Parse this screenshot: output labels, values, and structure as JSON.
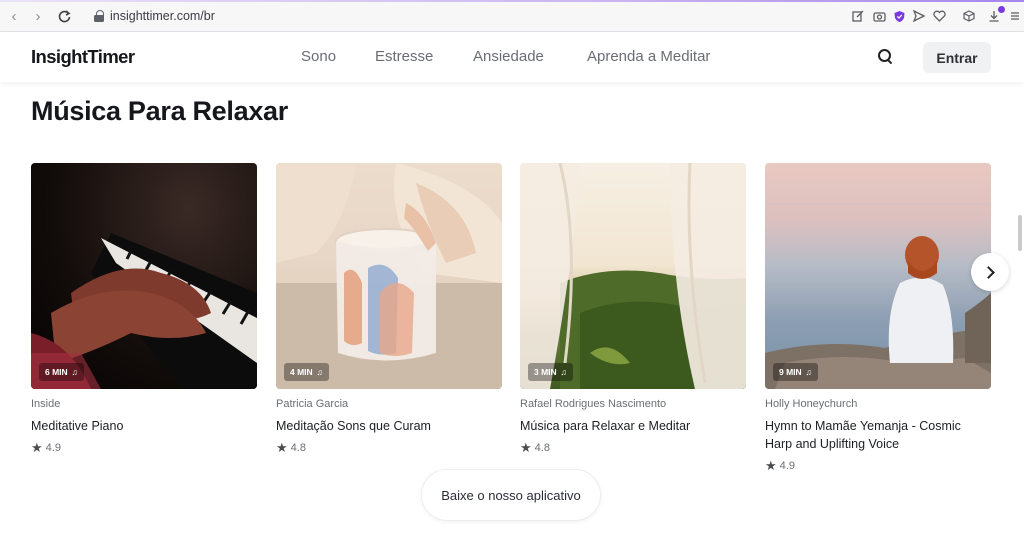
{
  "browser": {
    "url": "insighttimer.com/br",
    "back_icon": "arrow-left-icon",
    "forward_icon": "arrow-right-icon",
    "reload_icon": "reload-icon"
  },
  "header": {
    "logo": "InsightTimer",
    "nav": [
      "Sono",
      "Estresse",
      "Ansiedade",
      "Aprenda a Meditar"
    ],
    "login_label": "Entrar"
  },
  "section": {
    "title": "Música Para Relaxar"
  },
  "cards": [
    {
      "duration": "6 MIN",
      "author": "Inside",
      "title": "Meditative Piano",
      "rating": "4.9"
    },
    {
      "duration": "4 MIN",
      "author": "Patricia Garcia",
      "title": "Meditação Sons que Curam",
      "rating": "4.8"
    },
    {
      "duration": "3 MIN",
      "author": "Rafael Rodrigues Nascimento",
      "title": "Música para Relaxar e Meditar",
      "rating": "4.8"
    },
    {
      "duration": "9 MIN",
      "author": "Holly Honeychurch",
      "title": "Hymn to Mamãe Yemanja - Cosmic Harp and Uplifting Voice",
      "rating": "4.9"
    }
  ],
  "cta": {
    "label": "Baixe o nosso aplicativo"
  },
  "colors": {
    "brand_accent": "#7b39e0",
    "text_primary": "#181a1f",
    "text_muted": "#6b6e74",
    "button_bg": "#f0f1f3"
  }
}
